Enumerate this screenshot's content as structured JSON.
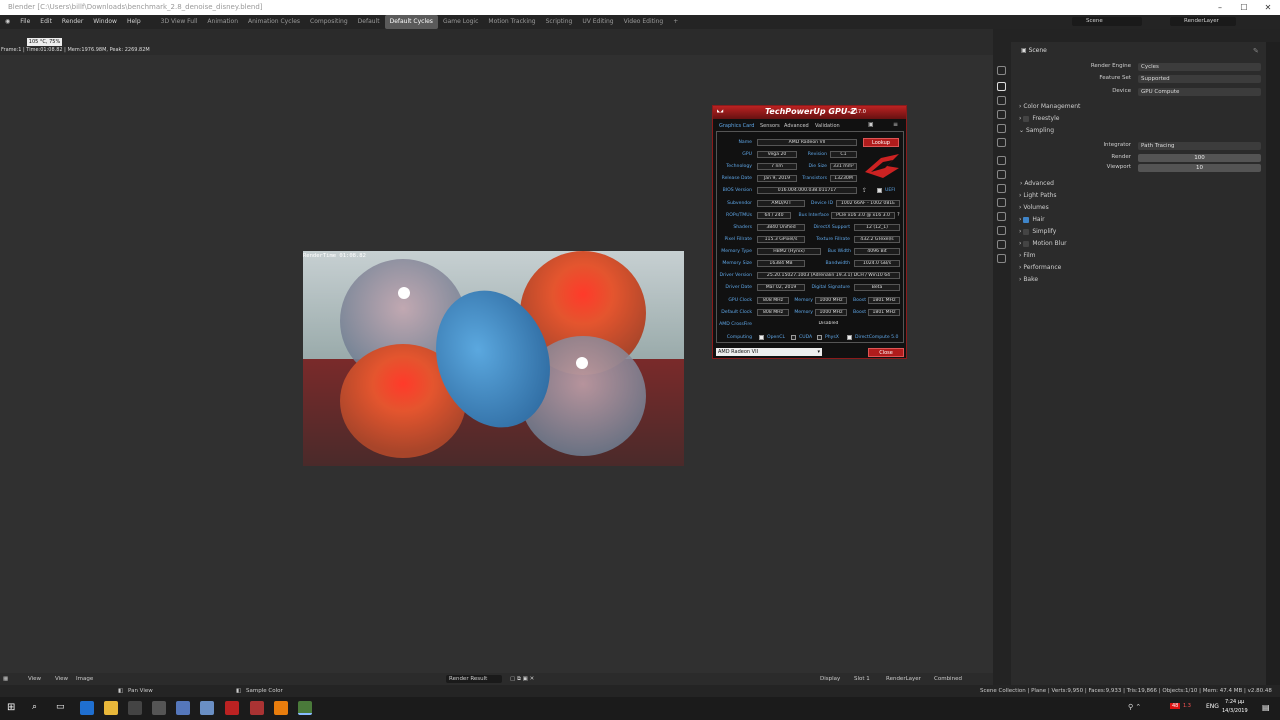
{
  "window": {
    "title": "Blender [C:\\Users\\billf\\Downloads\\benchmark_2.8_denoise_disney.blend]"
  },
  "menu": [
    "File",
    "Edit",
    "Render",
    "Window",
    "Help"
  ],
  "workspaces": [
    {
      "label": "3D View Full",
      "active": false
    },
    {
      "label": "Animation",
      "active": false
    },
    {
      "label": "Animation Cycles",
      "active": false
    },
    {
      "label": "Compositing",
      "active": false
    },
    {
      "label": "Default",
      "active": false
    },
    {
      "label": "Default Cycles",
      "active": true
    },
    {
      "label": "Game Logic",
      "active": false
    },
    {
      "label": "Motion Tracking",
      "active": false
    },
    {
      "label": "Scripting",
      "active": false
    },
    {
      "label": "UV Editing",
      "active": false
    },
    {
      "label": "Video Editing",
      "active": false
    }
  ],
  "topright": {
    "scene": "Scene",
    "render_layer": "RenderLayer"
  },
  "tooltip": "105 °C, 75%",
  "stats_line": "Frame:1 | Time:01:08.82 | Mem:1976.98M, Peak: 2269.82M",
  "render": {
    "overlay": "RenderTime 01:08.82"
  },
  "properties": {
    "header": "Scene",
    "render_engine": {
      "label": "Render Engine",
      "value": "Cycles"
    },
    "feature_set": {
      "label": "Feature Set",
      "value": "Supported"
    },
    "device": {
      "label": "Device",
      "value": "GPU Compute"
    },
    "sections": {
      "color_management": "Color Management",
      "freestyle": "Freestyle",
      "sampling": "Sampling",
      "advanced": "Advanced",
      "light_paths": "Light Paths",
      "volumes": "Volumes",
      "hair": "Hair",
      "simplify": "Simplify",
      "motion_blur": "Motion Blur",
      "film": "Film",
      "performance": "Performance",
      "bake": "Bake"
    },
    "integrator": {
      "label": "Integrator",
      "value": "Path Tracing"
    },
    "render_samples": {
      "label": "Render",
      "value": "100"
    },
    "viewport_samples": {
      "label": "Viewport",
      "value": "10"
    }
  },
  "image_header": {
    "view1": "View",
    "view2": "View",
    "image": "Image",
    "result": "Render Result",
    "display": "Display",
    "slot": "Slot 1",
    "layer": "RenderLayer",
    "pass": "Combined"
  },
  "statusbar": {
    "pan": "Pan View",
    "sample": "Sample Color",
    "info": "Scene Collection | Plane | Verts:9,950 | Faces:9,933 | Tris:19,866 | Objects:1/10 | Mem: 47.4 MB | v2.80.48"
  },
  "taskbar": {
    "lang": "ENG",
    "time": "7:24 μμ",
    "date": "14/3/2019",
    "badge": "48",
    "cpu": "1.3"
  },
  "gpuz": {
    "title": "TechPowerUp GPU-Z",
    "version": "2.17.0",
    "tabs": [
      "Graphics Card",
      "Sensors",
      "Advanced",
      "Validation"
    ],
    "lookup": "Lookup",
    "close": "Close",
    "uefi": "UEFI",
    "name": {
      "label": "Name",
      "value": "AMD Radeon VII"
    },
    "gpu": {
      "label": "GPU",
      "value": "Vega 20"
    },
    "revision": {
      "label": "Revision",
      "value": "C1"
    },
    "technology": {
      "label": "Technology",
      "value": "7 nm"
    },
    "die_size": {
      "label": "Die Size",
      "value": "331 mm²"
    },
    "release_date": {
      "label": "Release Date",
      "value": "Jan 9, 2019"
    },
    "transistors": {
      "label": "Transistors",
      "value": "13230M"
    },
    "bios": {
      "label": "BIOS Version",
      "value": "016.004.000.038.011717"
    },
    "subvendor": {
      "label": "Subvendor",
      "value": "AMD/ATI"
    },
    "device_id": {
      "label": "Device ID",
      "value": "1002 66AF - 1002 081E"
    },
    "rops": {
      "label": "ROPs/TMUs",
      "value": "64 / 240"
    },
    "bus_interface": {
      "label": "Bus Interface",
      "value": "PCIe x16 3.0 @ x16 3.0"
    },
    "shaders": {
      "label": "Shaders",
      "value": "3840 Unified"
    },
    "directx": {
      "label": "DirectX Support",
      "value": "12 (12_1)"
    },
    "pixel_fillrate": {
      "label": "Pixel Fillrate",
      "value": "115.3 GPixel/s"
    },
    "texture_fillrate": {
      "label": "Texture Fillrate",
      "value": "432.2 GTexel/s"
    },
    "memory_type": {
      "label": "Memory Type",
      "value": "HBM2 (Hynix)"
    },
    "bus_width": {
      "label": "Bus Width",
      "value": "4096 Bit"
    },
    "memory_size": {
      "label": "Memory Size",
      "value": "16384 MB"
    },
    "bandwidth": {
      "label": "Bandwidth",
      "value": "1024.0 GB/s"
    },
    "driver_version": {
      "label": "Driver Version",
      "value": "25.20.15027.1003 (Adrenalin 19.3.1) DCH / Win10 64"
    },
    "driver_date": {
      "label": "Driver Date",
      "value": "Mar 02, 2019"
    },
    "digital_signature": {
      "label": "Digital Signature",
      "value": "Beta"
    },
    "gpu_clock": {
      "label": "GPU Clock",
      "value": "808 MHz",
      "memory_label": "Memory",
      "memory": "1000 MHz",
      "boost_label": "Boost",
      "boost": "1801 MHz"
    },
    "default_clock": {
      "label": "Default Clock",
      "value": "808 MHz",
      "memory_label": "Memory",
      "memory": "1000 MHz",
      "boost_label": "Boost",
      "boost": "1801 MHz"
    },
    "crossfire": {
      "label": "AMD CrossFire",
      "value": "Disabled"
    },
    "computing": {
      "label": "Computing",
      "items": [
        "OpenCL",
        "CUDA",
        "PhysX",
        "DirectCompute 5.0"
      ]
    },
    "selected_card": "AMD Radeon VII"
  }
}
